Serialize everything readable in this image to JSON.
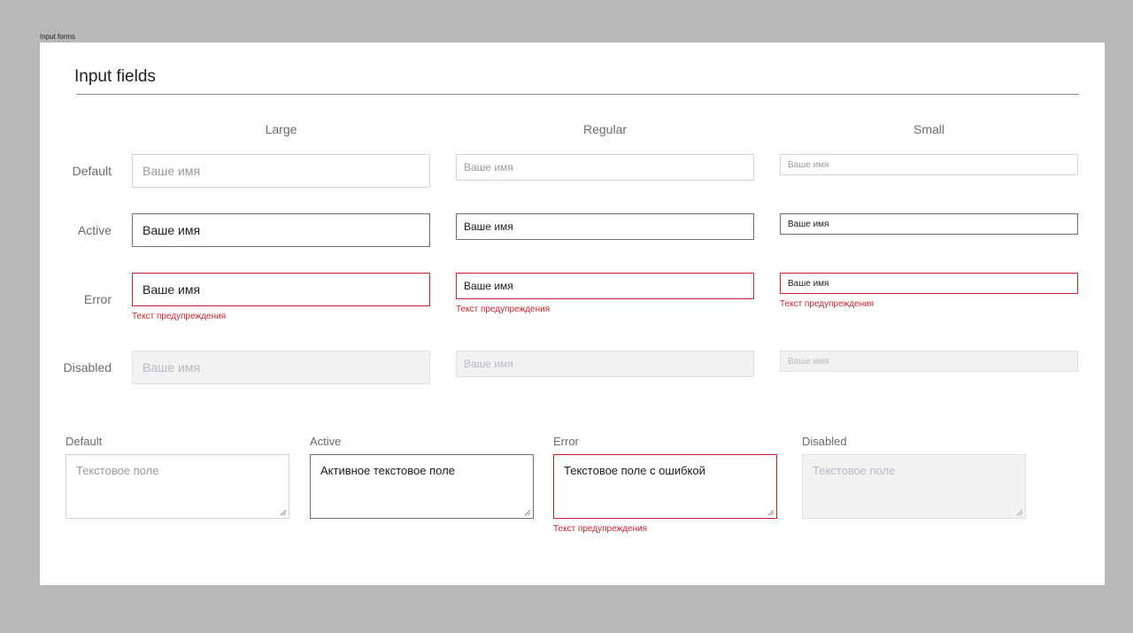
{
  "frame_label": "Input forms",
  "title": "Input fields",
  "columns": [
    "Large",
    "Regular",
    "Small"
  ],
  "rows": [
    "Default",
    "Active",
    "Error",
    "Disabled"
  ],
  "field_placeholder": "Ваше имя",
  "field_value": "Ваше имя",
  "error_hint": "Текст предупреждения",
  "textareas": {
    "labels": [
      "Default",
      "Active",
      "Error",
      "Disabled"
    ],
    "default_placeholder": "Текстовое поле",
    "active_value": "Активное текстовое поле",
    "error_value": "Текстовое поле с ошибкой",
    "disabled_placeholder": "Текстовое поле",
    "error_hint": "Текст предупреждения"
  },
  "colors": {
    "error": "#c4262e",
    "active_border": "#6e6e73",
    "disabled_bg": "#f2f2f4"
  }
}
